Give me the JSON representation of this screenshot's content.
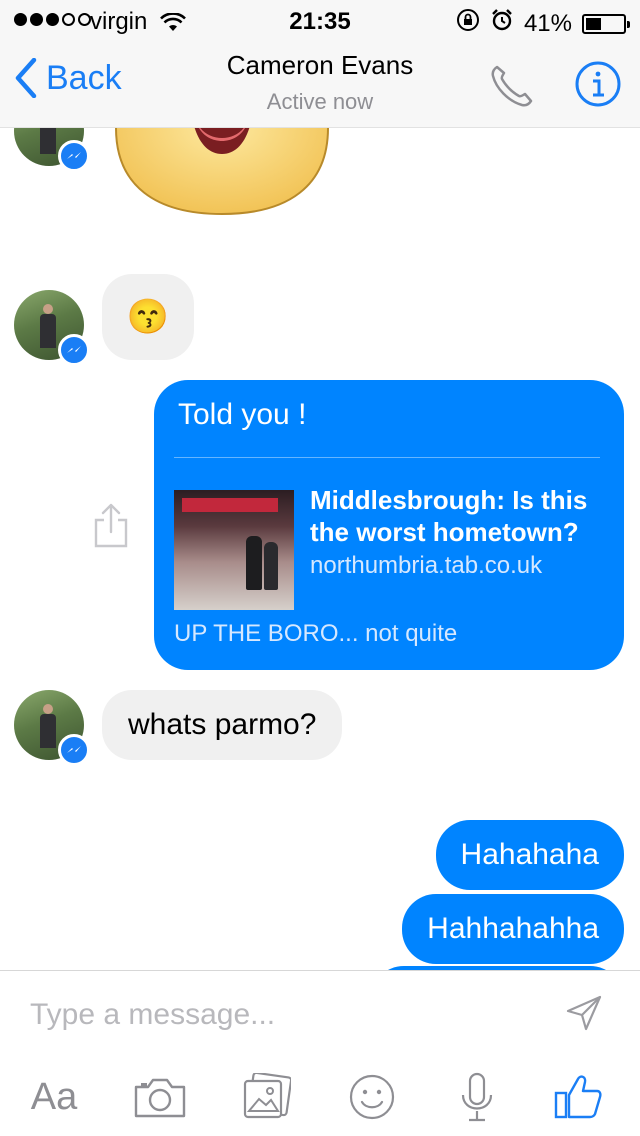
{
  "status_bar": {
    "carrier": "virgin",
    "time": "21:35",
    "battery": "41%",
    "battery_level": 0.41,
    "signal_bars": 3,
    "signal_total": 5
  },
  "header": {
    "back_label": "Back",
    "contact_name": "Cameron Evans",
    "presence": "Active now",
    "icons": [
      "phone-icon",
      "info-icon"
    ]
  },
  "messages": [
    {
      "direction": "incoming",
      "kind": "sticker",
      "sticker": "heart-eyes-face-sticker"
    },
    {
      "direction": "incoming",
      "kind": "emoji",
      "text": "😙"
    },
    {
      "direction": "outgoing",
      "kind": "link",
      "text": "Told you !",
      "link": {
        "title": "Middlesbrough: Is this the worst hometown?",
        "domain": "northumbria.tab.co.uk",
        "caption": "UP THE BORO... not quite"
      }
    },
    {
      "direction": "incoming",
      "kind": "text",
      "text": "whats parmo?"
    },
    {
      "direction": "outgoing",
      "kind": "text",
      "text": "Hahahaha"
    },
    {
      "direction": "outgoing",
      "kind": "text",
      "text": "Hahhahahha"
    }
  ],
  "composer": {
    "placeholder": "Type a message...",
    "aa_label": "Aa",
    "tools": [
      "text-format-icon",
      "camera-icon",
      "gallery-icon",
      "emoji-icon",
      "microphone-icon",
      "like-icon"
    ]
  },
  "colors": {
    "accent": "#1a7ef5",
    "outgoing_bubble": "#0084ff",
    "incoming_bubble": "#f0f0f0"
  }
}
